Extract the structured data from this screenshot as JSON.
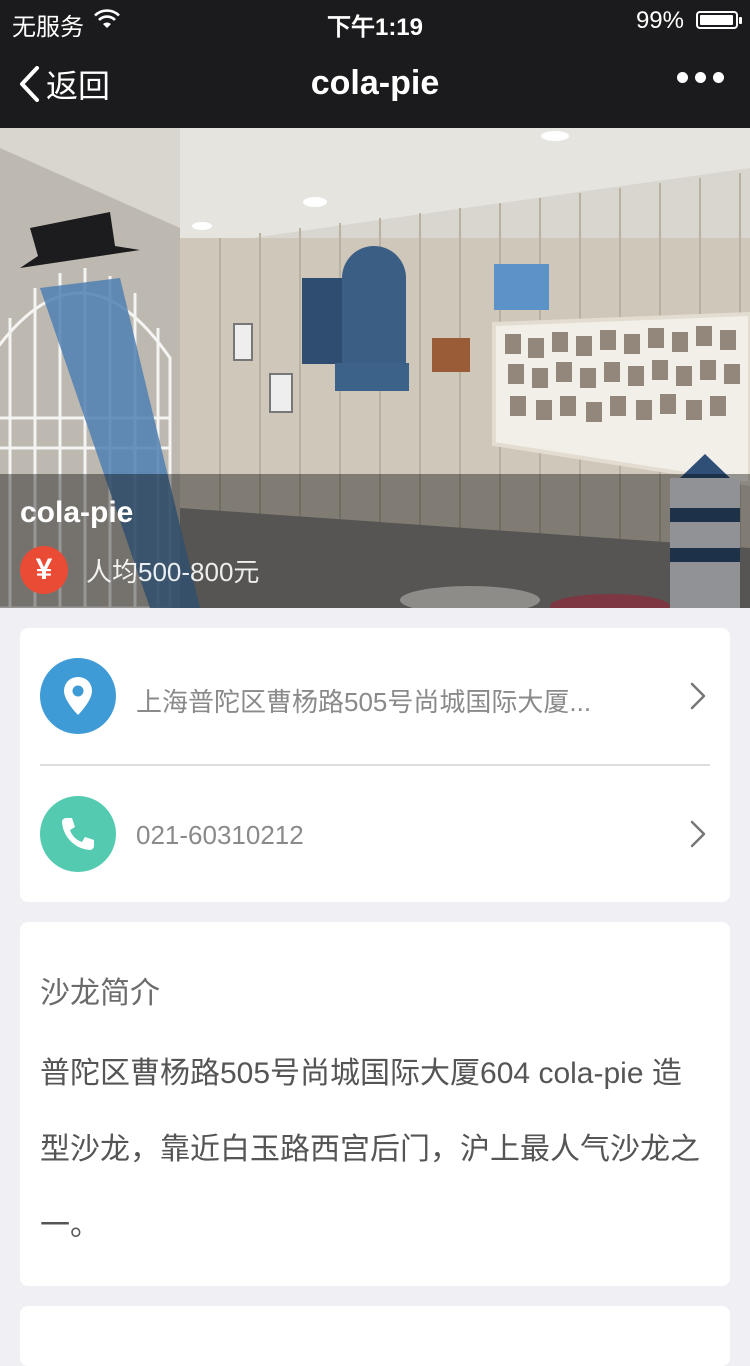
{
  "status_bar": {
    "carrier": "无服务",
    "time": "下午1:19",
    "battery": "99%",
    "battery_level": 0.99
  },
  "nav": {
    "back_label": "返回",
    "title": "cola-pie"
  },
  "hero": {
    "shop_name": "cola-pie",
    "price_icon": "¥",
    "price_text": "人均500-800元"
  },
  "contact": {
    "address": "上海普陀区曹杨路505号尚城国际大厦...",
    "phone": "021-60310212",
    "address_icon_color": "#3e9bd6",
    "phone_icon_color": "#54cbb0"
  },
  "intro": {
    "heading": "沙龙简介",
    "body": "普陀区曹杨路505号尚城国际大厦604 cola-pie 造型沙龙，靠近白玉路西宫后门，沪上最人气沙龙之一。"
  }
}
